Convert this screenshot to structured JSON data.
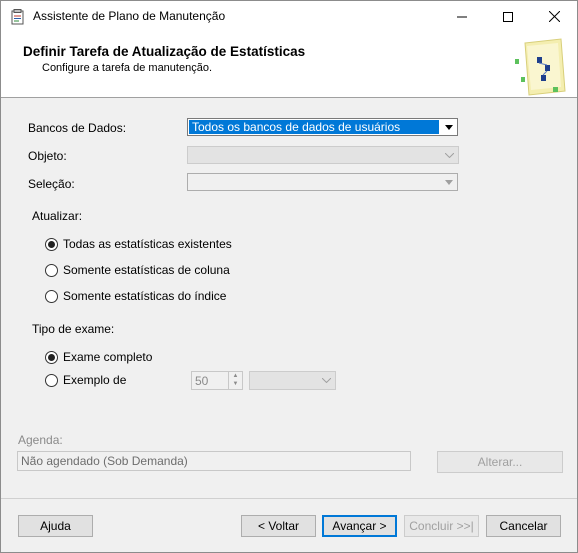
{
  "window": {
    "title": "Assistente de Plano de Manutenção",
    "icon": "wizard-app-icon",
    "controls": [
      "minimize-icon",
      "maximize-icon",
      "close-icon"
    ]
  },
  "header": {
    "title": "Definir Tarefa de Atualização de Estatísticas",
    "subtitle": "Configure a tarefa de manutenção.",
    "art": "maintenance-plan-illustration"
  },
  "form": {
    "databases_label": "Bancos de Dados:",
    "databases_value": "Todos os bancos de dados de usuários",
    "object_label": "Objeto:",
    "object_value": "",
    "selection_label": "Seleção:",
    "selection_value": "",
    "update_label": "Atualizar:",
    "update_options": [
      {
        "label": "Todas as estatísticas existentes",
        "selected": true
      },
      {
        "label": "Somente estatísticas de coluna",
        "selected": false
      },
      {
        "label": "Somente estatísticas do índice",
        "selected": false
      }
    ],
    "scan_label": "Tipo de exame:",
    "scan_options": [
      {
        "label": "Exame completo",
        "selected": true
      },
      {
        "label": "Exemplo de",
        "selected": false
      }
    ],
    "sample_value": "50",
    "sample_unit_value": "",
    "schedule_label": "Agenda:",
    "schedule_value": "Não agendado (Sob Demanda)",
    "change_label": "Alterar..."
  },
  "footer": {
    "help_label": "Ajuda",
    "back_label": "< Voltar",
    "next_label": "Avançar >",
    "finish_label": "Concluir >>|",
    "cancel_label": "Cancelar"
  },
  "colors": {
    "selection_blue": "#0078d7",
    "window_bg": "#f0f0f0",
    "disabled_text": "#a0a0a0"
  }
}
